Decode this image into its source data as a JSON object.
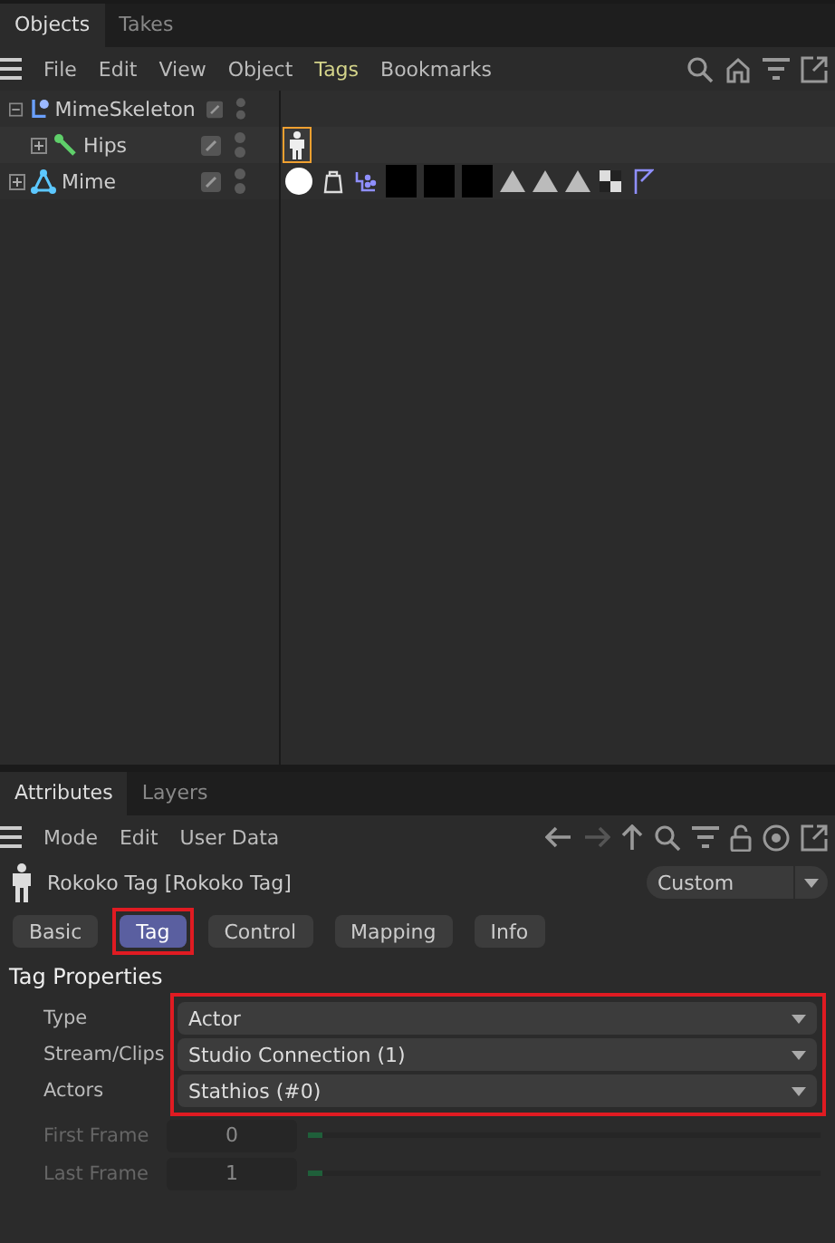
{
  "top_tabs": [
    {
      "label": "Objects",
      "selected": true
    },
    {
      "label": "Takes",
      "selected": false
    }
  ],
  "top_menu": [
    {
      "label": "File",
      "selected": false
    },
    {
      "label": "Edit",
      "selected": false
    },
    {
      "label": "View",
      "selected": false
    },
    {
      "label": "Object",
      "selected": false
    },
    {
      "label": "Tags",
      "selected": true
    },
    {
      "label": "Bookmarks",
      "selected": false
    }
  ],
  "objects": [
    {
      "name": "MimeSkeleton",
      "kind": "skeleton",
      "expanded": true,
      "children": [
        {
          "name": "Hips",
          "kind": "joint",
          "expanded": false,
          "tags": [
            {
              "kind": "figure",
              "selected": true
            }
          ]
        }
      ]
    },
    {
      "name": "Mime",
      "kind": "mesh",
      "expanded": false,
      "tags": [
        {
          "kind": "face",
          "selected": false
        },
        {
          "kind": "bag",
          "selected": false
        },
        {
          "kind": "cluster",
          "selected": false
        },
        {
          "kind": "black",
          "selected": false
        },
        {
          "kind": "black",
          "selected": false
        },
        {
          "kind": "black",
          "selected": false
        },
        {
          "kind": "triangle",
          "selected": false
        },
        {
          "kind": "triangle",
          "selected": false
        },
        {
          "kind": "triangle",
          "selected": false
        },
        {
          "kind": "checker",
          "selected": false
        },
        {
          "kind": "flag",
          "selected": false
        }
      ]
    }
  ],
  "attr_tabs": [
    {
      "label": "Attributes",
      "selected": true
    },
    {
      "label": "Layers",
      "selected": false
    }
  ],
  "attr_menu": [
    "Mode",
    "Edit",
    "User Data"
  ],
  "header": {
    "title": "Rokoko Tag [Rokoko Tag]",
    "mode": "Custom"
  },
  "sections": [
    {
      "label": "Basic",
      "selected": false,
      "highlighted": false
    },
    {
      "label": "Tag",
      "selected": true,
      "highlighted": true
    },
    {
      "label": "Control",
      "selected": false,
      "highlighted": false
    },
    {
      "label": "Mapping",
      "selected": false,
      "highlighted": false
    },
    {
      "label": "Info",
      "selected": false,
      "highlighted": false
    }
  ],
  "group_title": "Tag Properties",
  "dropdowns_highlighted": true,
  "dropdowns": [
    {
      "label": "Type",
      "value": "Actor"
    },
    {
      "label": "Stream/Clips",
      "value": "Studio Connection (1)"
    },
    {
      "label": "Actors",
      "value": "Stathios (#0)"
    }
  ],
  "sliders": [
    {
      "label": "First Frame",
      "value": "0",
      "level": 0.03,
      "disabled": true
    },
    {
      "label": "Last Frame",
      "value": "1",
      "level": 0.03,
      "disabled": true
    }
  ]
}
